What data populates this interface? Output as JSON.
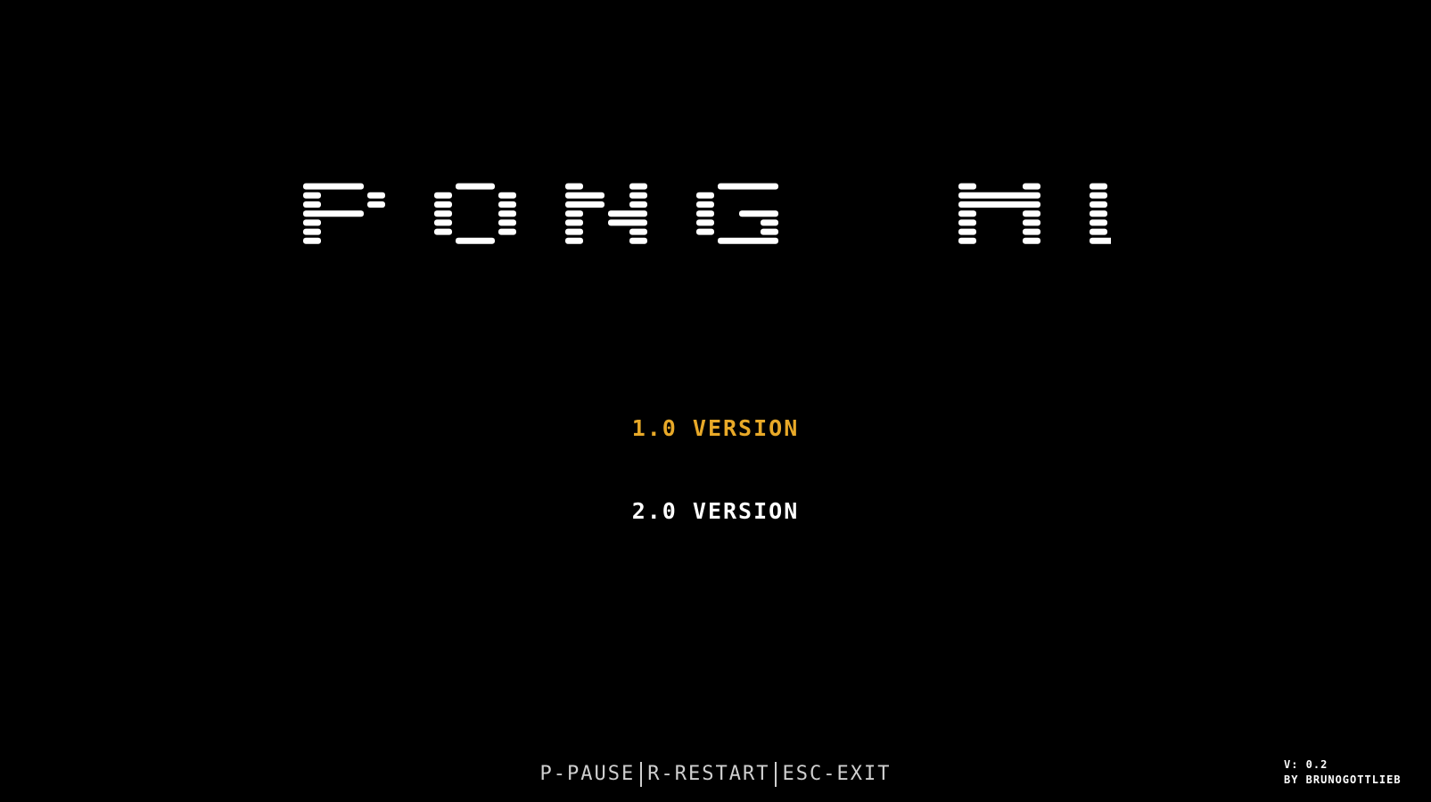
{
  "title": "PONG ML",
  "colors": {
    "background": "#000000",
    "selected": "#e8a928",
    "menu_text": "#ffffff",
    "controls_text": "#cfcfcf"
  },
  "menu": {
    "items": [
      {
        "label": "1.0 VERSION",
        "selected": true
      },
      {
        "label": "2.0 VERSION",
        "selected": false
      }
    ]
  },
  "controls": {
    "pause": "P-PAUSE",
    "restart": "R-RESTART",
    "exit": "ESC-EXIT"
  },
  "credit": {
    "version": "V: 0.2",
    "author": "BY BRUNOGOTTLIEB"
  }
}
